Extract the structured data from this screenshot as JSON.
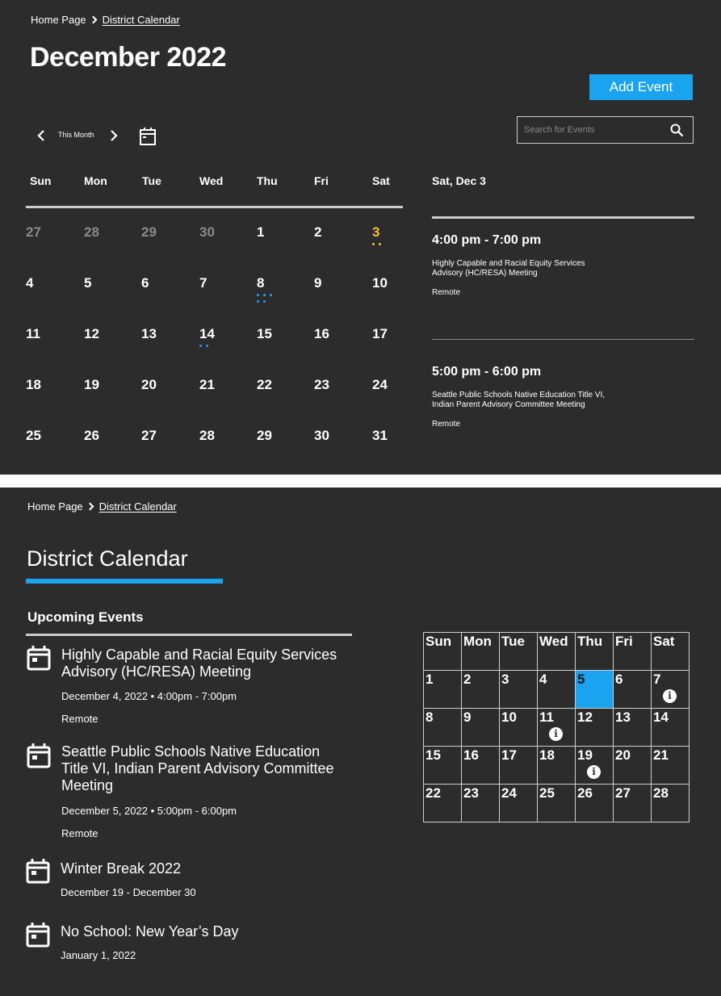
{
  "top": {
    "breadcrumb": {
      "home": "Home Page",
      "current": "District Calendar"
    },
    "month_title": "December 2022",
    "add_event_label": "Add Event",
    "search": {
      "placeholder": "Search for Events",
      "value": ""
    },
    "this_month_label": "This Month",
    "weekdays": [
      "Sun",
      "Mon",
      "Tue",
      "Wed",
      "Thu",
      "Fri",
      "Sat"
    ],
    "weeks": [
      [
        "27",
        "28",
        "29",
        "30",
        "1",
        "2",
        "3"
      ],
      [
        "4",
        "5",
        "6",
        "7",
        "8",
        "9",
        "10"
      ],
      [
        "11",
        "12",
        "13",
        "14",
        "15",
        "16",
        "17"
      ],
      [
        "18",
        "19",
        "20",
        "21",
        "22",
        "23",
        "24"
      ],
      [
        "25",
        "26",
        "27",
        "28",
        "29",
        "30",
        "31"
      ]
    ],
    "selected_day": "3",
    "event_dots": {
      "3": 2,
      "8": 5,
      "14": 2
    },
    "side": {
      "date": "Sat, Dec 3",
      "events": [
        {
          "time": "4:00 pm - 7:00 pm",
          "title": "Highly Capable and Racial Equity Services Advisory (HC/RESA) Meeting",
          "location": "Remote"
        },
        {
          "time": "5:00 pm - 6:00 pm",
          "title": "Seattle Public Schools Native Education Title VI, Indian Parent Advisory Committee Meeting",
          "location": "Remote"
        }
      ]
    },
    "colors": {
      "accent": "#1aa3ef",
      "selected": "#f5c32c",
      "background": "#2c2c2c"
    }
  },
  "bottom": {
    "breadcrumb": {
      "home": "Home Page",
      "current": "District Calendar"
    },
    "title": "District Calendar",
    "upcoming_label": "Upcoming Events",
    "events": [
      {
        "title": "Highly Capable and Racial Equity Services Advisory (HC/RESA) Meeting",
        "date": "December 4, 2022 • 4:00pm - 7:00pm",
        "location": "Remote",
        "icon": "calendar-icon"
      },
      {
        "title": "Seattle Public Schools Native Education Title VI, Indian Parent Advisory Committee Meeting",
        "date": "December 5, 2022 • 5:00pm - 6:00pm",
        "location": "Remote",
        "icon": "calendar-icon"
      },
      {
        "title": "Winter Break 2022",
        "date": "December 19 - December 30",
        "icon": "calendar-icon"
      },
      {
        "title": "No School: New Year’s Day",
        "date": "January 1, 2022",
        "icon": "calendar-icon"
      }
    ],
    "mini_calendar": {
      "weekdays": [
        "Sun",
        "Mon",
        "Tue",
        "Wed",
        "Thu",
        "Fri",
        "Sat"
      ],
      "weeks": [
        [
          "1",
          "2",
          "3",
          "4",
          "5",
          "6",
          "7"
        ],
        [
          "8",
          "9",
          "10",
          "11",
          "12",
          "13",
          "14"
        ],
        [
          "15",
          "16",
          "17",
          "18",
          "19",
          "20",
          "21"
        ],
        [
          "22",
          "23",
          "24",
          "25",
          "26",
          "27",
          "28"
        ]
      ],
      "today": "5",
      "info_days": [
        "7",
        "11",
        "19"
      ],
      "info_glyph": "i"
    }
  }
}
